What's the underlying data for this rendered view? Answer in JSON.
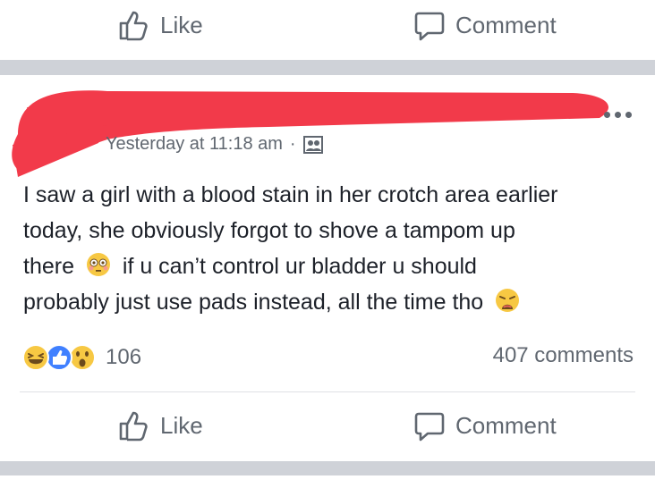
{
  "top_actions": {
    "like_label": "Like",
    "comment_label": "Comment"
  },
  "post": {
    "timestamp": "Yesterday at 11:18 am",
    "separator": "·",
    "audience_icon": "friends-icon",
    "more_icon": "more-dots-icon",
    "text_line1": "I saw a girl with a blood stain in her crotch area earlier",
    "text_line2": "today, she obviously forgot to shove a tampom up",
    "text_line3a": "there",
    "text_line3b": "if u can’t control ur bladder u should",
    "text_line4": "probably just use pads instead, all the time tho",
    "emoji_1": "flushed-face-emoji",
    "emoji_2": "weary-face-emoji"
  },
  "reactions": {
    "icons": [
      "laughing-reaction-icon",
      "like-reaction-icon",
      "wow-reaction-icon"
    ],
    "count": "106"
  },
  "comments_count": "407 comments",
  "bottom_actions": {
    "like_label": "Like",
    "comment_label": "Comment"
  },
  "colors": {
    "redaction": "#f23a4a",
    "accent": "#4080ff",
    "muted": "#606770"
  }
}
